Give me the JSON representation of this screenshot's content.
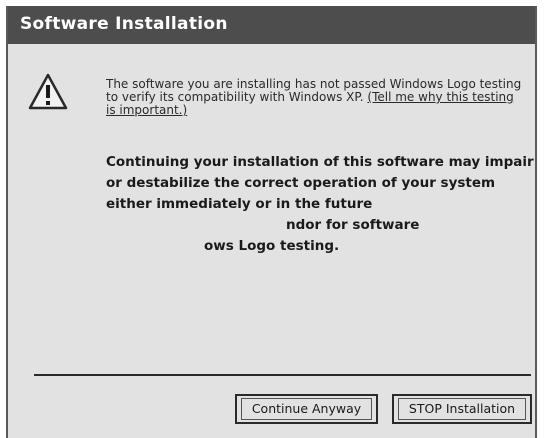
{
  "window": {
    "title": "Software Installation"
  },
  "message": {
    "text": "The software you are installing has not passed Windows Logo testing to verify its compatibility with Windows XP. ",
    "link": "(Tell me why this testing is important.)"
  },
  "warning": {
    "line1": "Continuing your installation of this software may impair",
    "line2": "or destabilize the correct operation of your system",
    "line3": "either immediately or in the future",
    "line4": "ndor for software",
    "line5": "ows Logo testing."
  },
  "buttons": {
    "continue_label": "Continue Anyway",
    "stop_label": "STOP Installation"
  },
  "icons": {
    "warning": "warning-icon"
  }
}
